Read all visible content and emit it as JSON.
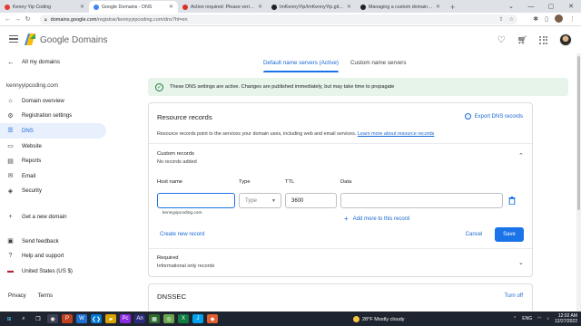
{
  "browser": {
    "tabs": [
      {
        "title": "Kenny Yip Coding",
        "favicon_color": "#e53935",
        "active": false
      },
      {
        "title": "Google Domains - DNS",
        "favicon_color": "#4285f4",
        "active": true
      },
      {
        "title": "Action required: Please verify yo...",
        "favicon_color": "#d93025",
        "active": false
      },
      {
        "title": "ImKennyYip/ImKennyYip.github...",
        "favicon_color": "#202124",
        "active": false
      },
      {
        "title": "Managing a custom domain for ...",
        "favicon_color": "#202124",
        "active": false
      }
    ],
    "url_host": "domains.google.com",
    "url_path": "/registrar/kennyyipcoding.com/dns?hl=en"
  },
  "header": {
    "brand_google": "Google",
    "brand_domains": "Domains"
  },
  "sidebar": {
    "back_label": "All my domains",
    "domain": "kennyyipcoding.com",
    "items": [
      {
        "label": "Domain overview",
        "icon": "home-icon",
        "glyph": "⌂"
      },
      {
        "label": "Registration settings",
        "icon": "settings-icon",
        "glyph": "⚙"
      },
      {
        "label": "DNS",
        "icon": "dns-icon",
        "glyph": "☰"
      },
      {
        "label": "Website",
        "icon": "website-icon",
        "glyph": "▭"
      },
      {
        "label": "Reports",
        "icon": "reports-icon",
        "glyph": "▤"
      },
      {
        "label": "Email",
        "icon": "email-icon",
        "glyph": "✉"
      },
      {
        "label": "Security",
        "icon": "security-icon",
        "glyph": "◈"
      }
    ],
    "get_domain": {
      "label": "Get a new domain",
      "glyph": "+"
    },
    "footer_items": [
      {
        "label": "Send feedback",
        "glyph": "▣"
      },
      {
        "label": "Help and support",
        "glyph": "?"
      },
      {
        "label": "United States (US $)",
        "glyph": "▬"
      }
    ],
    "privacy": "Privacy",
    "terms": "Terms"
  },
  "main": {
    "tabs": {
      "default": "Default name servers (Active)",
      "custom": "Custom name servers"
    },
    "banner": "These DNS settings are active. Changes are published immediately, but may take time to propagate",
    "resource_records": {
      "title": "Resource records",
      "export": "Export DNS records",
      "desc": "Resource records point to the services your domain uses, including web and email services.",
      "learn_more": "Learn more about resource records",
      "custom_title": "Custom records",
      "custom_sub": "No records added",
      "columns": {
        "host": "Host name",
        "type": "Type",
        "ttl": "TTL",
        "data": "Data"
      },
      "type_placeholder": "Type",
      "ttl_value": "3600",
      "host_hint": "kennyyipcoding.com",
      "add_more": "Add more to this record",
      "create_new": "Create new record",
      "cancel": "Cancel",
      "save": "Save",
      "required_title": "Required",
      "required_sub": "Informational only records"
    },
    "dnssec": {
      "title": "DNSSEC",
      "action": "Turn off"
    }
  },
  "taskbar": {
    "weather": "28°F  Mostly cloudy",
    "lang": "ENG",
    "time": "12:02 AM",
    "date": "12/27/2022"
  },
  "colors": {
    "accent": "#1a73e8",
    "banner_bg": "#e6f4ea",
    "active_nav_bg": "#e8f0fe"
  }
}
